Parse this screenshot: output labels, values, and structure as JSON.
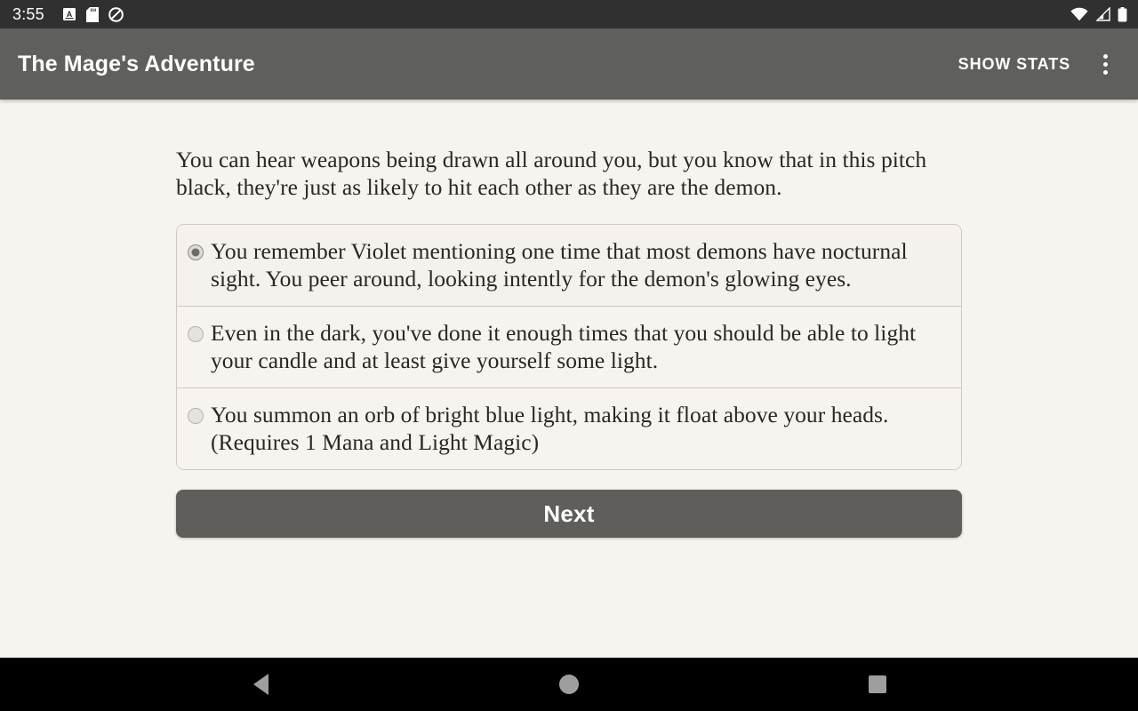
{
  "status_bar": {
    "time": "3:55",
    "left_icons": [
      "font-size-a-icon",
      "sd-card-icon",
      "do-not-disturb-icon"
    ],
    "right_icons": [
      "wifi-icon",
      "cellular-signal-icon",
      "battery-icon"
    ],
    "background_color": "#303030"
  },
  "app_bar": {
    "title": "The Mage's Adventure",
    "action_label": "SHOW STATS",
    "overflow_icon": "more-vert-icon",
    "background_color": "#5f5f5c",
    "text_color": "#ffffff"
  },
  "main": {
    "prompt": "You can hear weapons being drawn all around you, but you know that in this pitch black, they're just as likely to hit each other as they are the demon.",
    "options": [
      {
        "label": "You remember Violet mentioning one time that most demons have nocturnal sight. You peer around, looking intently for the demon's glowing eyes.",
        "selected": true
      },
      {
        "label": "Even in the dark, you've done it enough times that you should be able to light your candle and at least give yourself some light.",
        "selected": false
      },
      {
        "label": "You summon an orb of bright blue light, making it float above your heads. (Requires 1 Mana and Light Magic)",
        "selected": false
      }
    ],
    "next_label": "Next",
    "next_color": "#5f5e5b",
    "page_background": "#f7f4ef",
    "card_border_color": "#cfc9c0",
    "body_text_color": "#2a2724"
  },
  "nav_bar": {
    "buttons": [
      "back-nav-icon",
      "home-nav-icon",
      "recents-nav-icon"
    ],
    "background_color": "#000000",
    "icon_color": "#9e9e9e"
  }
}
